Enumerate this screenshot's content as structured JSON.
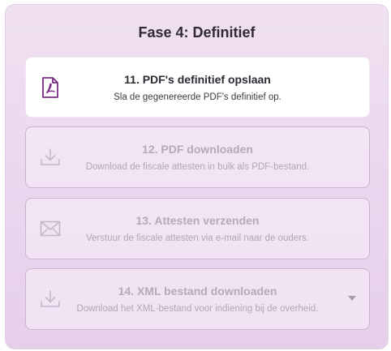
{
  "phase": {
    "title": "Fase 4: Definitief"
  },
  "steps": [
    {
      "title": "11. PDF's definitief opslaan",
      "description": "Sla de gegenereerde PDF's definitief op.",
      "icon": "pdf-file-icon",
      "state": "active"
    },
    {
      "title": "12. PDF downloaden",
      "description": "Download de fiscale attesten in bulk als PDF-bestand.",
      "icon": "download-icon",
      "state": "disabled"
    },
    {
      "title": "13. Attesten verzenden",
      "description": "Verstuur de fiscale attesten via e-mail naar de ouders.",
      "icon": "envelope-icon",
      "state": "disabled"
    },
    {
      "title": "14. XML bestand downloaden",
      "description": "Download het XML-bestand voor indiening bij de overheid.",
      "icon": "download-icon",
      "state": "disabled"
    }
  ],
  "colors": {
    "accent": "#7a2b86",
    "disabled_icon": "#c6b7c9"
  }
}
